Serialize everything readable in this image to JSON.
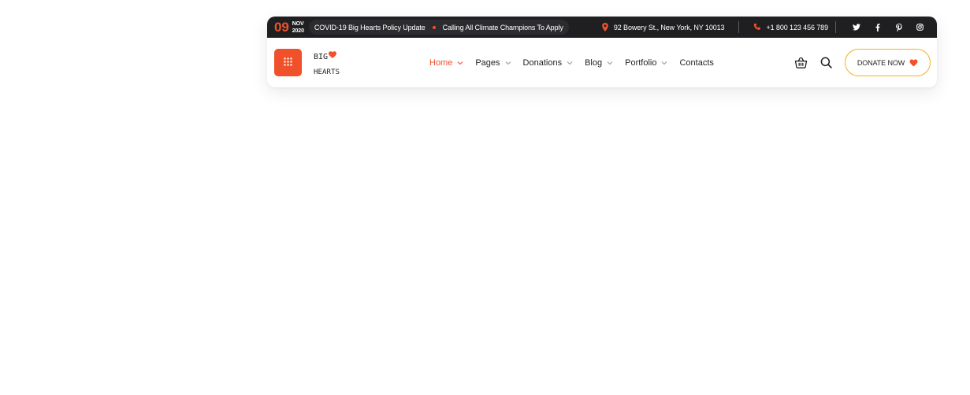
{
  "topbar": {
    "date_day": "09",
    "date_month": "NOV",
    "date_year": "2020",
    "news_1": "COVID-19 Big Hearts Policy Update",
    "news_2": "Calling All Climate Champions To Apply",
    "address": "92 Bowery St., New York, NY 10013",
    "phone": "+1 800 123 456 789",
    "social": [
      {
        "icon": "twitter-icon",
        "glyph": "𝕥"
      },
      {
        "icon": "facebook-icon",
        "glyph": "f"
      },
      {
        "icon": "pinterest-icon",
        "glyph": "p"
      },
      {
        "icon": "instagram-icon",
        "glyph": "◎"
      }
    ]
  },
  "logo": {
    "line1": "BIG",
    "line2": "HEARTS"
  },
  "nav": {
    "items": [
      {
        "label": "Home",
        "active": true,
        "dropdown": true
      },
      {
        "label": "Pages",
        "active": false,
        "dropdown": true
      },
      {
        "label": "Donations",
        "active": false,
        "dropdown": true
      },
      {
        "label": "Blog",
        "active": false,
        "dropdown": true
      },
      {
        "label": "Portfolio",
        "active": false,
        "dropdown": true
      },
      {
        "label": "Contacts",
        "active": false,
        "dropdown": false
      }
    ],
    "cart_icon": "basket-icon",
    "search_icon": "search-icon",
    "donate_label": "DONATE NOW"
  },
  "colors": {
    "accent": "#f0512a",
    "dark": "#1f1f22",
    "donate_border": "#f3b21a"
  }
}
